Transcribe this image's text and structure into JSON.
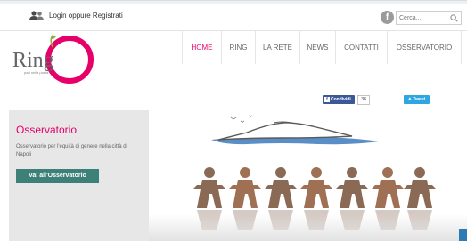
{
  "topbar": {
    "login_text": "Login oppure Registrati",
    "facebook_glyph": "f",
    "search_placeholder": "Cerca..."
  },
  "logo": {
    "name": "Ring",
    "tagline": "pari nella parità"
  },
  "nav": {
    "items": [
      {
        "label": "HOME",
        "active": true
      },
      {
        "label": "RING",
        "active": false
      },
      {
        "label": "LA RETE",
        "active": false
      },
      {
        "label": "NEWS",
        "active": false
      },
      {
        "label": "CONTATTI",
        "active": false
      },
      {
        "label": "OSSERVATORIO",
        "active": false
      }
    ]
  },
  "share": {
    "facebook_label": "Condividi",
    "facebook_count": "38",
    "twitter_label": "Tweet"
  },
  "panel": {
    "title": "Osservatorio",
    "description": "Osservatorio per l'equità di genere nella città di Napoli",
    "button_label": "Vai all'Osservatorio"
  },
  "colors": {
    "accent": "#e5006a",
    "button": "#3d8077",
    "facebook": "#3b5998",
    "twitter": "#2ea7e0",
    "figure": "#8a6a55",
    "sea": "#5a8ec7"
  }
}
